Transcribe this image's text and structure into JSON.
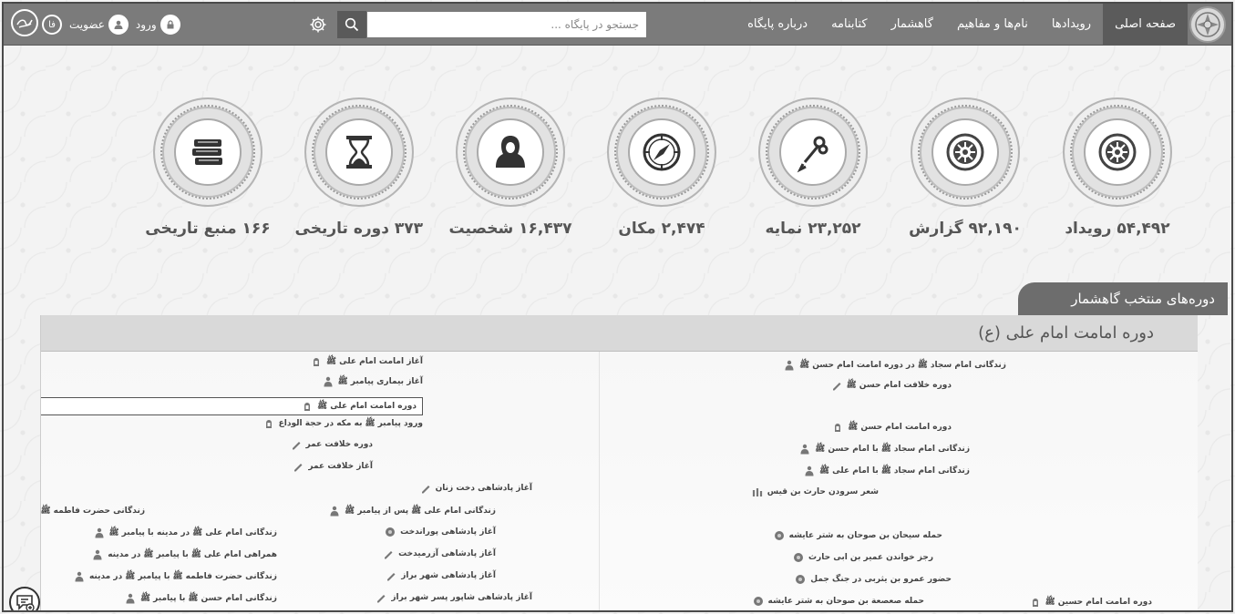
{
  "header": {
    "nav": [
      "صفحه اصلی",
      "رویدادها",
      "نام‌ها و مفاهیم",
      "گاهشمار",
      "کتابنامه",
      "درباره پایگاه"
    ],
    "search_placeholder": "جستجو در پایگاه ...",
    "login": "ورود",
    "signup": "عضویت",
    "lang": "فا"
  },
  "stats": [
    {
      "label": "۵۴,۴۹۲ رویداد",
      "icon": "gear-icon"
    },
    {
      "label": "۹۲,۱۹۰ گزارش",
      "icon": "gear-icon"
    },
    {
      "label": "۲۳,۲۵۲ نمایه",
      "icon": "key-pen-icon"
    },
    {
      "label": "۲,۴۷۴ مکان",
      "icon": "compass-icon"
    },
    {
      "label": "۱۶,۴۳۷ شخصیت",
      "icon": "person-icon"
    },
    {
      "label": "۳۷۳ دوره تاریخی",
      "icon": "hourglass-icon"
    },
    {
      "label": "۱۶۶ منبع تاریخی",
      "icon": "books-icon"
    }
  ],
  "section": {
    "title": "دوره‌های منتخب گاهشمار",
    "panel_title": "دوره امامت امام علی (ع)"
  },
  "timeline": {
    "events": [
      {
        "text": "زندگانی امام سجاد ﷺ در دوره امامت امام حسن ﷺ",
        "icon": "person"
      },
      {
        "text": "دوره خلافت امام حسن ﷺ",
        "icon": "pen"
      },
      {
        "text": "دوره امامت امام حسن ﷺ",
        "icon": "seal"
      },
      {
        "text": "زندگانی امام سجاد ﷺ با امام حسن ﷺ",
        "icon": "person"
      },
      {
        "text": "زندگانی امام سجاد ﷺ با امام علی ﷺ",
        "icon": "person"
      },
      {
        "text": "شعر سرودن حارث بن قیس",
        "icon": "column"
      },
      {
        "text": "حمله سیحان بن صوحان به شتر عایشه",
        "icon": "dot"
      },
      {
        "text": "رجز خواندن عمیر بن ابی حارث",
        "icon": "dot"
      },
      {
        "text": "حضور عمرو بن یثربی در جنگ جمل",
        "icon": "dot"
      },
      {
        "text": "حمله صعصعة بن صوحان به شتر عایشه",
        "icon": "dot"
      },
      {
        "text": "دوره امامت امام حسین ﷺ",
        "icon": "seal"
      },
      {
        "text": "آغاز امامت امام علی ﷺ",
        "icon": "seal"
      },
      {
        "text": "آغاز بیماری پیامبر ﷺ",
        "icon": "person"
      },
      {
        "text": "دوره امامت امام علی ﷺ",
        "icon": "seal"
      },
      {
        "text": "ورود پیامبر ﷺ به مکه در حجة الوداع",
        "icon": "seal"
      },
      {
        "text": "دوره خلافت عمر",
        "icon": "pen"
      },
      {
        "text": "آغاز خلافت عمر",
        "icon": "pen"
      },
      {
        "text": "آغاز پادشاهی دخت زنان",
        "icon": "pen"
      },
      {
        "text": "زندگانی امام علی ﷺ پس از پیامبر ﷺ",
        "icon": "person"
      },
      {
        "text": "آغاز پادشاهی پوراندخت",
        "icon": "dot"
      },
      {
        "text": "آغاز پادشاهی آزرمیدخت",
        "icon": "pen"
      },
      {
        "text": "آغاز پادشاهی شهر براز",
        "icon": "pen"
      },
      {
        "text": "آغاز پادشاهی شاپور پسر شهر براز",
        "icon": "pen"
      },
      {
        "text": "زندگانی حضرت فاطمه ﷺ با پیامبر",
        "icon": "none"
      },
      {
        "text": "زندگانی امام علی ﷺ در مدینه با پیامبر ﷺ",
        "icon": "person"
      },
      {
        "text": "همراهی امام علی ﷺ با پیامبر ﷺ در مدینه",
        "icon": "person"
      },
      {
        "text": "زندگانی حضرت فاطمه ﷺ با پیامبر ﷺ در مدینه",
        "icon": "person"
      },
      {
        "text": "زندگانی امام حسن ﷺ با پیامبر ﷺ",
        "icon": "person"
      }
    ]
  }
}
